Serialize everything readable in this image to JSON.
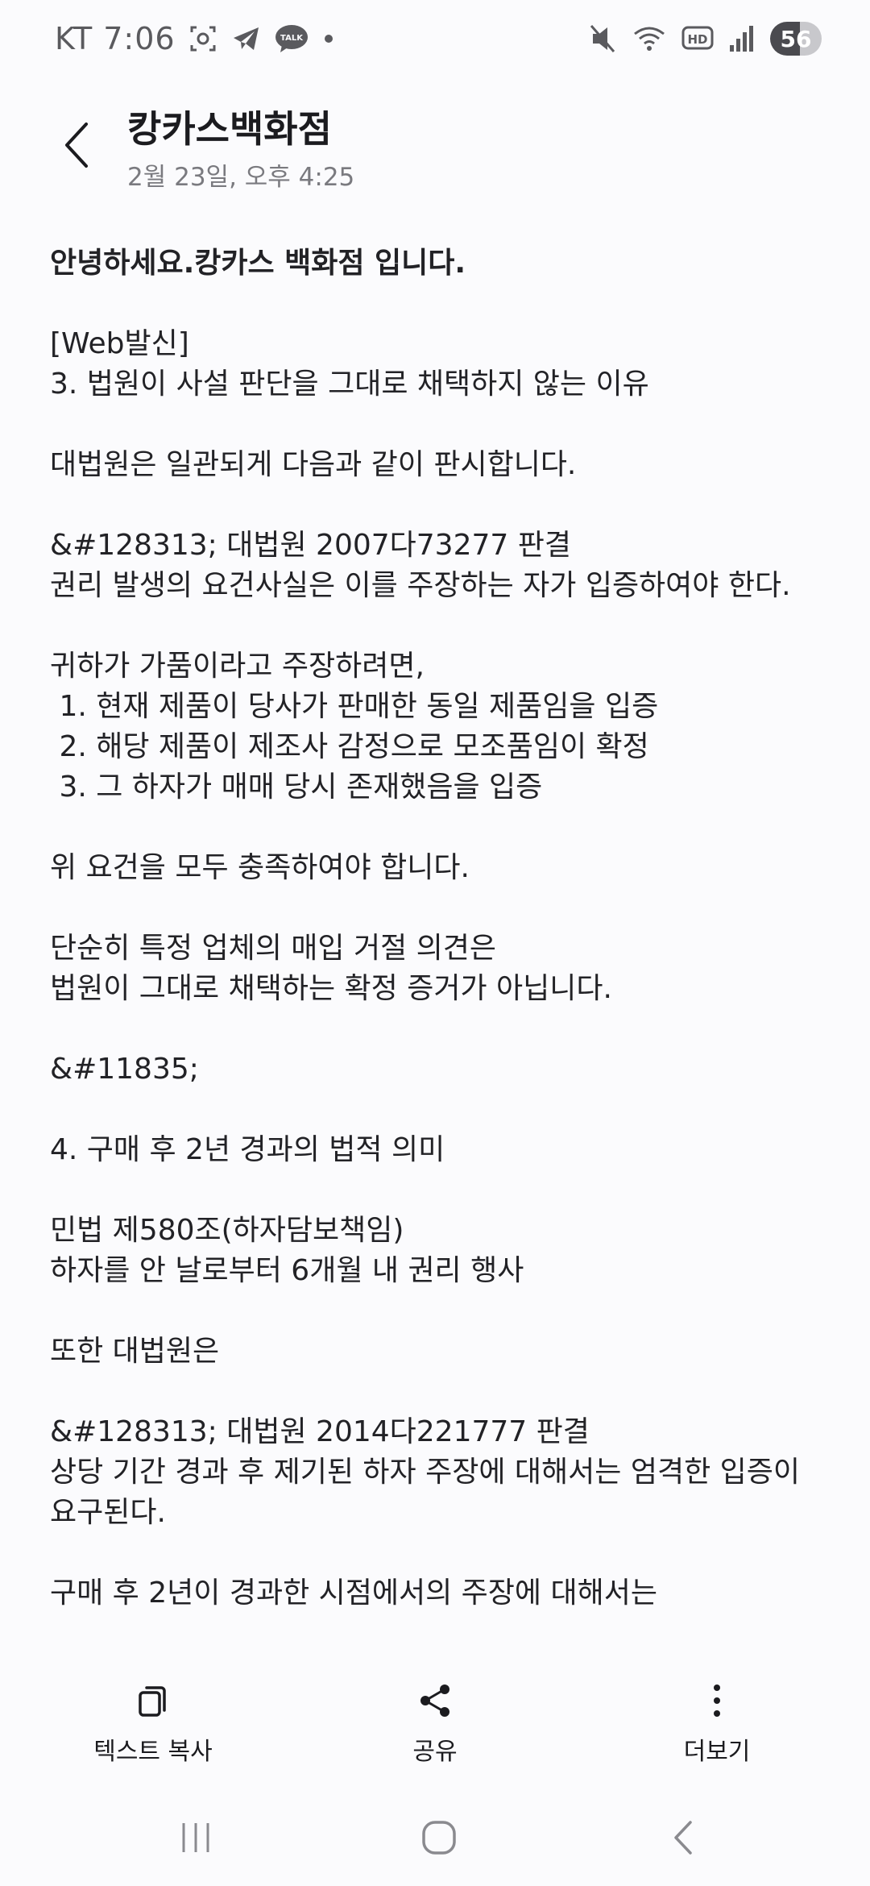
{
  "status_bar": {
    "carrier_time": "KT 7:06",
    "hd_label": "HD",
    "battery_level": "56",
    "talk_label": "TALK"
  },
  "header": {
    "title": "캉카스백화점",
    "timestamp": "2월 23일, 오후 4:25"
  },
  "message": {
    "greeting": "안녕하세요.캉카스 백화점 입니다.",
    "lines": [
      "[Web발신]",
      "3. 법원이 사설 판단을 그대로 채택하지 않는 이유",
      "",
      "대법원은 일관되게 다음과 같이 판시합니다.",
      "",
      "&#128313; 대법원 2007다73277 판결",
      "권리 발생의 요건사실은 이를 주장하는 자가 입증하여야 한다.",
      "",
      "귀하가 가품이라고 주장하려면,",
      " 1. 현재 제품이 당사가 판매한 동일 제품임을 입증",
      " 2. 해당 제품이 제조사 감정으로 모조품임이 확정",
      " 3. 그 하자가 매매 당시 존재했음을 입증",
      "",
      "위 요건을 모두 충족하여야 합니다.",
      "",
      "단순히 특정 업체의 매입 거절 의견은",
      "법원이 그대로 채택하는 확정 증거가 아닙니다.",
      "",
      "&#11835;",
      "",
      "4. 구매 후 2년 경과의 법적 의미",
      "",
      "민법 제580조(하자담보책임)",
      "하자를 안 날로부터 6개월 내 권리 행사",
      "",
      "또한 대법원은",
      "",
      "&#128313; 대법원 2014다221777 판결",
      "상당 기간 경과 후 제기된 하자 주장에 대해서는 엄격한 입증이 요구된다.",
      "",
      "구매 후 2년이 경과한 시점에서의 주장에 대해서는"
    ]
  },
  "actions": {
    "copy_label": "텍스트 복사",
    "share_label": "공유",
    "more_label": "더보기"
  }
}
